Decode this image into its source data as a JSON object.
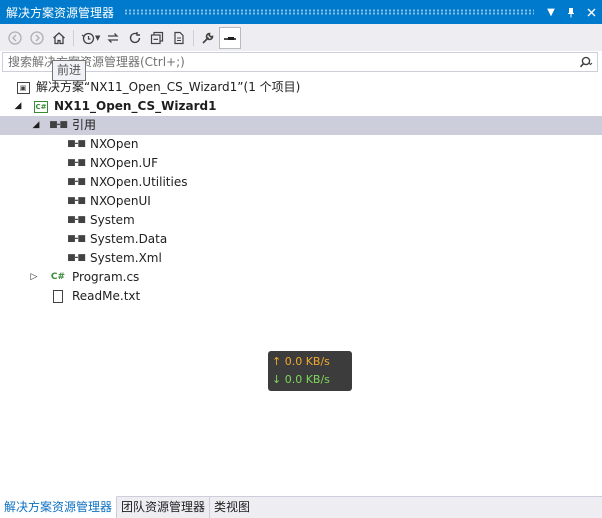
{
  "window": {
    "title": "解决方案资源管理器",
    "dropdown_icon": "chevron-down-icon",
    "pin_icon": "pin-icon",
    "close_icon": "close-icon"
  },
  "toolbar": {
    "buttons": [
      {
        "name": "back",
        "icon": "back-arrow-icon",
        "enabled": false
      },
      {
        "name": "forward",
        "icon": "forward-arrow-icon",
        "enabled": false
      },
      {
        "name": "home",
        "icon": "home-icon",
        "enabled": true
      },
      {
        "name": "pending-changes-filter",
        "icon": "history-icon",
        "enabled": true
      },
      {
        "name": "sync-with-active-document",
        "icon": "sync-icon",
        "enabled": true
      },
      {
        "name": "refresh",
        "icon": "refresh-icon",
        "enabled": true
      },
      {
        "name": "collapse-all",
        "icon": "collapse-all-icon",
        "enabled": true
      },
      {
        "name": "show-all-files",
        "icon": "show-all-files-icon",
        "enabled": true
      },
      {
        "name": "properties",
        "icon": "wrench-icon",
        "enabled": true
      },
      {
        "name": "preview-selected",
        "icon": "preview-icon",
        "enabled": true,
        "active": true
      }
    ],
    "tooltip": "前进"
  },
  "search": {
    "placeholder": "搜索解决方案资源管理器(Ctrl+;)",
    "value": "",
    "icon": "search-icon"
  },
  "tree": {
    "solution_label": "解决方案“NX11_Open_CS_Wizard1”(1 个项目)",
    "project_label": "NX11_Open_CS_Wizard1",
    "references_label": "引用",
    "references": [
      "NXOpen",
      "NXOpen.UF",
      "NXOpen.Utilities",
      "NXOpenUI",
      "System",
      "System.Data",
      "System.Xml"
    ],
    "files": [
      {
        "label": "Program.cs",
        "type": "cs",
        "expandable": true
      },
      {
        "label": "ReadMe.txt",
        "type": "txt",
        "expandable": false
      }
    ],
    "project_icon_text": "C#",
    "file_icon_text": "C#"
  },
  "netspeed": {
    "upload": "0.0 KB/s",
    "download": "0.0 KB/s",
    "up_arrow": "↑",
    "down_arrow": "↓",
    "up_color": "#f0a830",
    "down_color": "#7cd85a"
  },
  "bottom_tabs": [
    {
      "label": "解决方案资源管理器",
      "active": true
    },
    {
      "label": "团队资源管理器",
      "active": false
    },
    {
      "label": "类视图",
      "active": false
    }
  ],
  "colors": {
    "accent": "#007acc",
    "selection": "#cccedb",
    "cs_green": "#388a34"
  }
}
